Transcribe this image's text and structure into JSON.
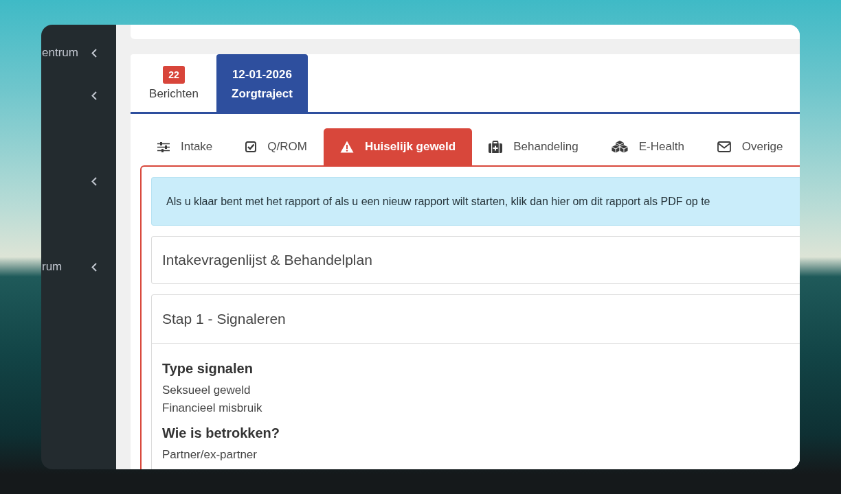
{
  "sidebar": {
    "items": [
      {
        "label": "entrum",
        "expanded": false
      },
      {
        "expanded": false
      },
      {
        "expanded": false
      },
      {
        "label": "rum",
        "expanded": false
      }
    ]
  },
  "record_tabs": [
    {
      "badge": "22",
      "label": "Berichten",
      "selected": false
    },
    {
      "date": "12-01-2026",
      "label": "Zorgtraject",
      "selected": true
    }
  ],
  "section_tabs": [
    {
      "label": "Intake",
      "selected": false
    },
    {
      "label": "Q/ROM",
      "selected": false
    },
    {
      "label": "Huiselijk geweld",
      "selected": true
    },
    {
      "label": "Behandeling",
      "selected": false
    },
    {
      "label": "E-Health",
      "selected": false
    },
    {
      "label": "Overige",
      "selected": false
    }
  ],
  "alert": {
    "text": "Als u klaar bent met het rapport of als u een nieuw rapport wilt starten, klik dan hier om dit rapport als PDF op te"
  },
  "panels": [
    {
      "title": "Intakevragenlijst & Behandelplan"
    },
    {
      "title": "Stap 1 - Signaleren",
      "fields": [
        {
          "heading": "Type signalen",
          "values": [
            "Seksueel geweld",
            "Financieel misbruik"
          ]
        },
        {
          "heading": "Wie is betrokken?",
          "values": [
            "Partner/ex-partner"
          ]
        }
      ]
    }
  ]
}
